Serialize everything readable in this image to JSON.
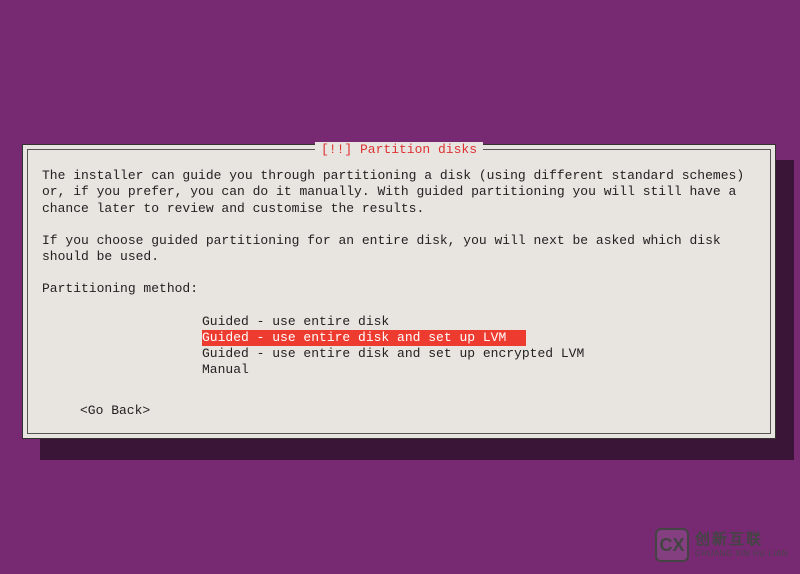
{
  "dialog": {
    "title": "[!!] Partition disks",
    "paragraph1": "The installer can guide you through partitioning a disk (using different standard schemes) or, if you prefer, you can do it manually. With guided partitioning you will still have a chance later to review and customise the results.",
    "paragraph2": "If you choose guided partitioning for an entire disk, you will next be asked which disk should be used.",
    "method_label": "Partitioning method:",
    "options": [
      "Guided - use entire disk",
      "Guided - use entire disk and set up LVM",
      "Guided - use entire disk and set up encrypted LVM",
      "Manual"
    ],
    "selected_index": 1,
    "go_back": "<Go Back>"
  },
  "watermark": {
    "logo_text": "CX",
    "cn": "创新互联",
    "en": "CHUANG XIN HU LIAN"
  },
  "colors": {
    "background": "#772a72",
    "dialog_bg": "#e8e4e0",
    "title_color": "#d33",
    "selection_bg": "#ee3b2f"
  }
}
